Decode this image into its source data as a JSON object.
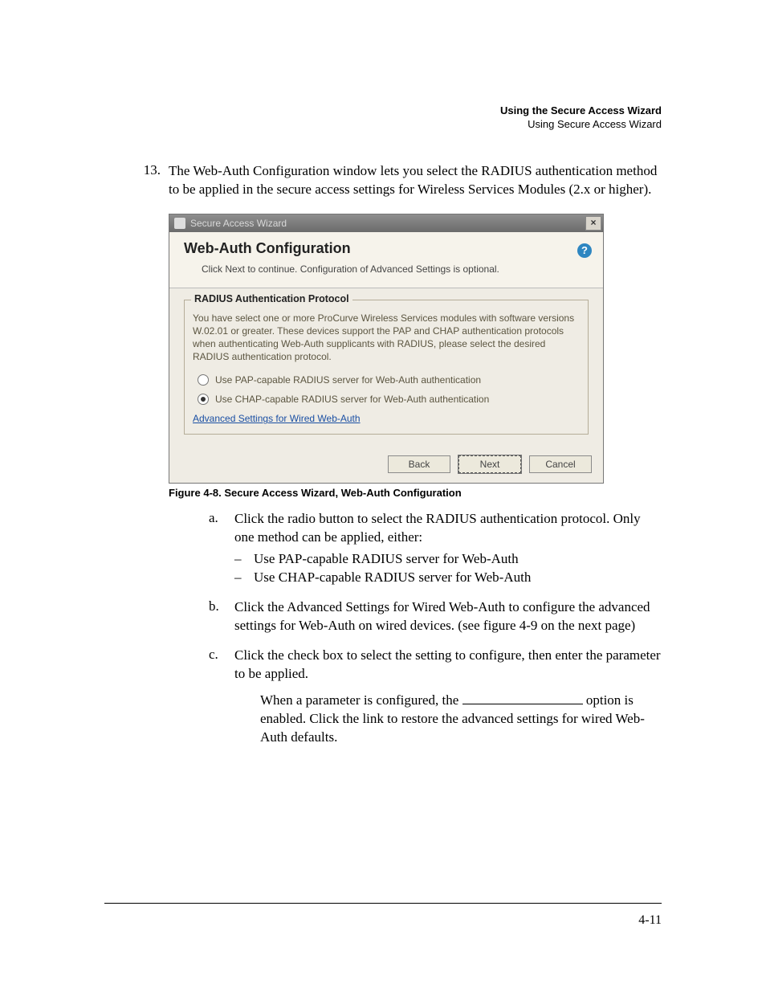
{
  "header": {
    "title_bold": "Using the Secure Access Wizard",
    "subtitle": "Using Secure Access Wizard"
  },
  "step": {
    "number": "13.",
    "text": "The Web-Auth Configuration window lets you select the RADIUS authentication method to be applied in the secure access settings for Wireless Services Modules (2.x or higher)."
  },
  "dialog": {
    "window_title": "Secure Access Wizard",
    "close_glyph": "×",
    "help_glyph": "?",
    "heading": "Web-Auth Configuration",
    "subheading": "Click Next to continue. Configuration of Advanced Settings is optional.",
    "group_legend": "RADIUS Authentication Protocol",
    "group_text": "You have select one or more ProCurve Wireless Services modules with software versions W.02.01 or greater. These devices support the PAP and CHAP authentication protocols when authenticating Web-Auth supplicants with RADIUS, please select the desired RADIUS authentication protocol.",
    "radio_pap": "Use PAP-capable RADIUS server for Web-Auth authentication",
    "radio_chap": "Use CHAP-capable RADIUS server for Web-Auth authentication",
    "adv_link": "Advanced Settings for Wired Web-Auth",
    "back": "Back",
    "next": "Next",
    "cancel": "Cancel"
  },
  "figure_caption": "Figure 4-8. Secure Access Wizard, Web-Auth Configuration",
  "sub": {
    "a": {
      "letter": "a.",
      "text": "Click the radio button to select the RADIUS authentication protocol. Only one method can be applied, either:",
      "dash1": "Use PAP-capable RADIUS server for Web-Auth",
      "dash2": "Use CHAP-capable RADIUS server for Web-Auth"
    },
    "b": {
      "letter": "b.",
      "text": "Click the Advanced Settings for Wired Web-Auth to configure the advanced settings for Web-Auth on wired devices. (see figure 4-9 on the next page)"
    },
    "c": {
      "letter": "c.",
      "text": "Click the check box to select the setting to configure, then enter the parameter to be applied.",
      "extra_before": "When a parameter is configured, the ",
      "extra_after": " option is enabled. Click the link to restore the advanced settings for wired Web-Auth defaults."
    }
  },
  "page_number": "4-11"
}
